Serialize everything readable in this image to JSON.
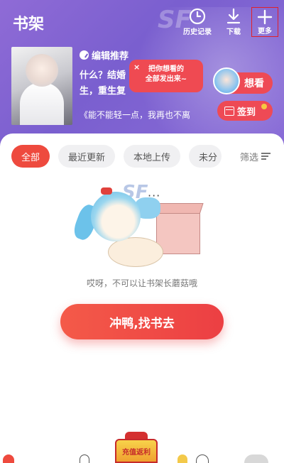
{
  "header": {
    "title": "书架",
    "actions": [
      {
        "label": "历史记录",
        "icon": "clock-icon"
      },
      {
        "label": "下载",
        "icon": "download-icon"
      },
      {
        "label": "更多",
        "icon": "plus-icon"
      }
    ],
    "bg_logo": "SF"
  },
  "featured": {
    "tag": "编辑推荐",
    "line1": "什么？结婚",
    "line2": "生，重生复",
    "quote": "《能不能轻一点，我再也不离",
    "bubble_line1": "把你想看的",
    "bubble_line2": "全部发出来~",
    "bubble_close": "×",
    "want_label": "想看",
    "checkin_label": "签到"
  },
  "filters": {
    "chips": [
      {
        "label": "全部",
        "active": true
      },
      {
        "label": "最近更新",
        "active": false
      },
      {
        "label": "本地上传",
        "active": false
      },
      {
        "label": "未分",
        "active": false
      }
    ],
    "filter_label": "筛选"
  },
  "empty_state": {
    "illus_text": "SF",
    "dots": "···",
    "message": "哎呀，不可以让书架长蘑菇哦",
    "cta_label": "冲鸭,找书去"
  },
  "promo": {
    "label": "充值返利"
  },
  "colors": {
    "header_purple": "#7a5fcf",
    "accent_red": "#ee4a3e",
    "chip_bg": "#f0f0f2"
  }
}
